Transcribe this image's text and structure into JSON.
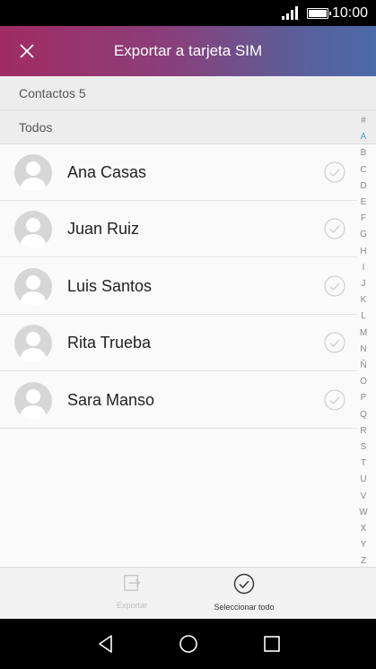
{
  "status_bar": {
    "time": "10:00"
  },
  "header": {
    "title": "Exportar a tarjeta SIM"
  },
  "summary": {
    "count_label": "Contactos 5",
    "group_label": "Todos"
  },
  "contacts": [
    {
      "name": "Ana Casas"
    },
    {
      "name": "Juan Ruiz"
    },
    {
      "name": "Luis Santos"
    },
    {
      "name": "Rita Trueba"
    },
    {
      "name": "Sara Manso"
    }
  ],
  "alpha_index": [
    "#",
    "A",
    "B",
    "C",
    "D",
    "E",
    "F",
    "G",
    "H",
    "I",
    "J",
    "K",
    "L",
    "M",
    "N",
    "Ñ",
    "O",
    "P",
    "Q",
    "R",
    "S",
    "T",
    "U",
    "V",
    "W",
    "X",
    "Y",
    "Z"
  ],
  "alpha_active": "A",
  "bottom_bar": {
    "export_label": "Exportar",
    "select_all_label": "Seleccionar todo"
  },
  "colors": {
    "accent": "#4aa5b8",
    "header_start": "#a12b64",
    "header_end": "#4b6aa8"
  }
}
